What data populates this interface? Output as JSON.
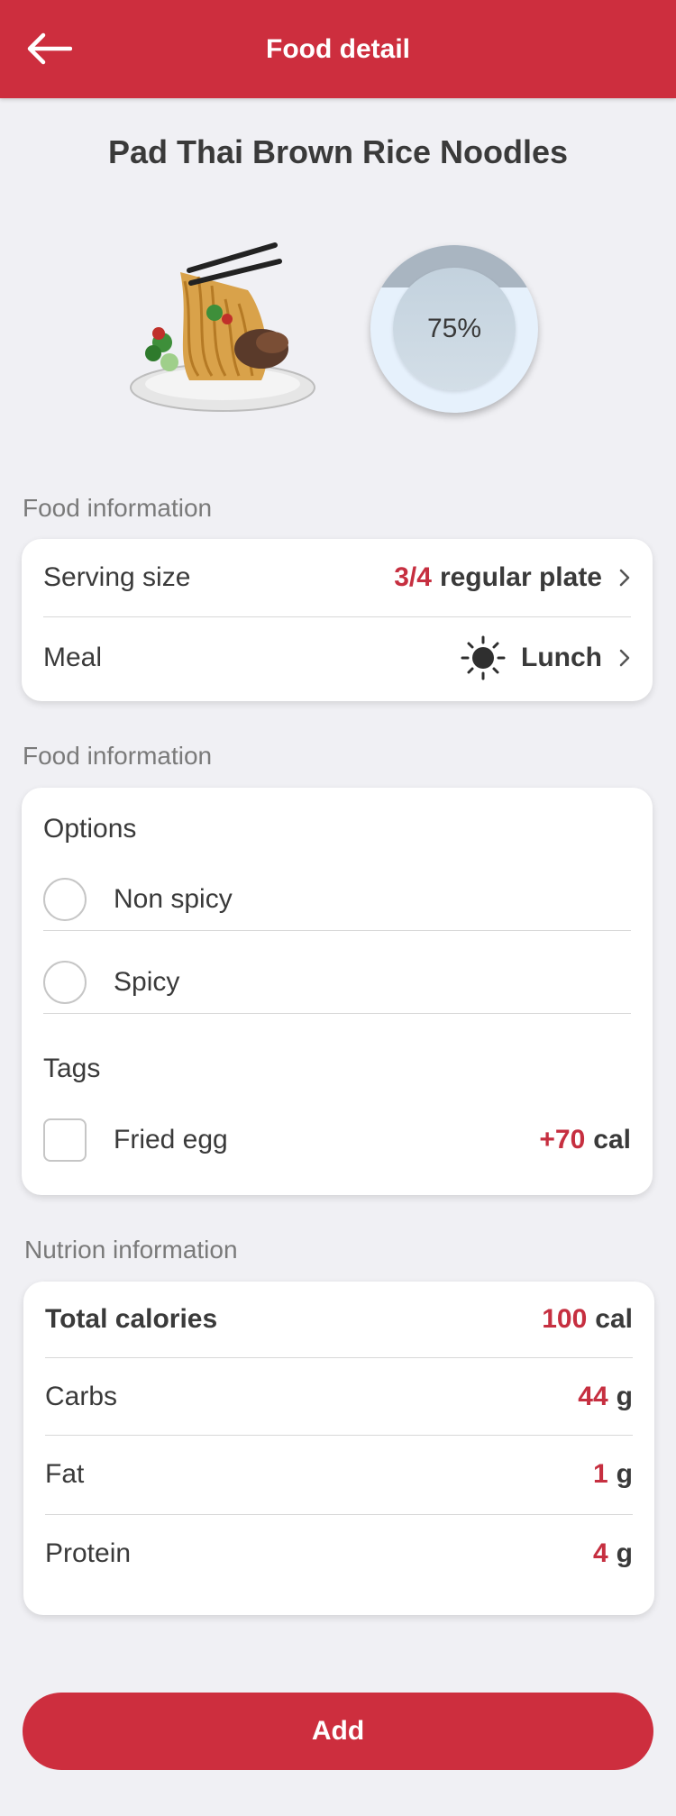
{
  "header": {
    "title": "Food detail"
  },
  "food": {
    "name": "Pad Thai Brown Rice Noodles",
    "portion_percent_label": "75%",
    "portion_fraction": 0.75
  },
  "sections": {
    "food_info_1": "Food information",
    "food_info_2": "Food information",
    "nutrition": "Nutrion information"
  },
  "serving": {
    "label": "Serving size",
    "amount": "3/4",
    "unit": "regular plate"
  },
  "meal": {
    "label": "Meal",
    "value": "Lunch"
  },
  "options": {
    "title": "Options",
    "items": [
      "Non spicy",
      "Spicy"
    ]
  },
  "tags": {
    "title": "Tags",
    "items": [
      {
        "label": "Fried egg",
        "amount": "+70",
        "unit": "cal"
      }
    ]
  },
  "nutrition": {
    "total": {
      "label": "Total calories",
      "value": "100",
      "unit": "cal"
    },
    "rows": [
      {
        "label": "Carbs",
        "value": "44",
        "unit": "g"
      },
      {
        "label": "Fat",
        "value": "1",
        "unit": "g"
      },
      {
        "label": "Protein",
        "value": "4",
        "unit": "g"
      }
    ]
  },
  "actions": {
    "add_label": "Add"
  },
  "colors": {
    "brand_red": "#cd2e3e",
    "value_red": "#c62f40",
    "background": "#f0f0f4"
  }
}
